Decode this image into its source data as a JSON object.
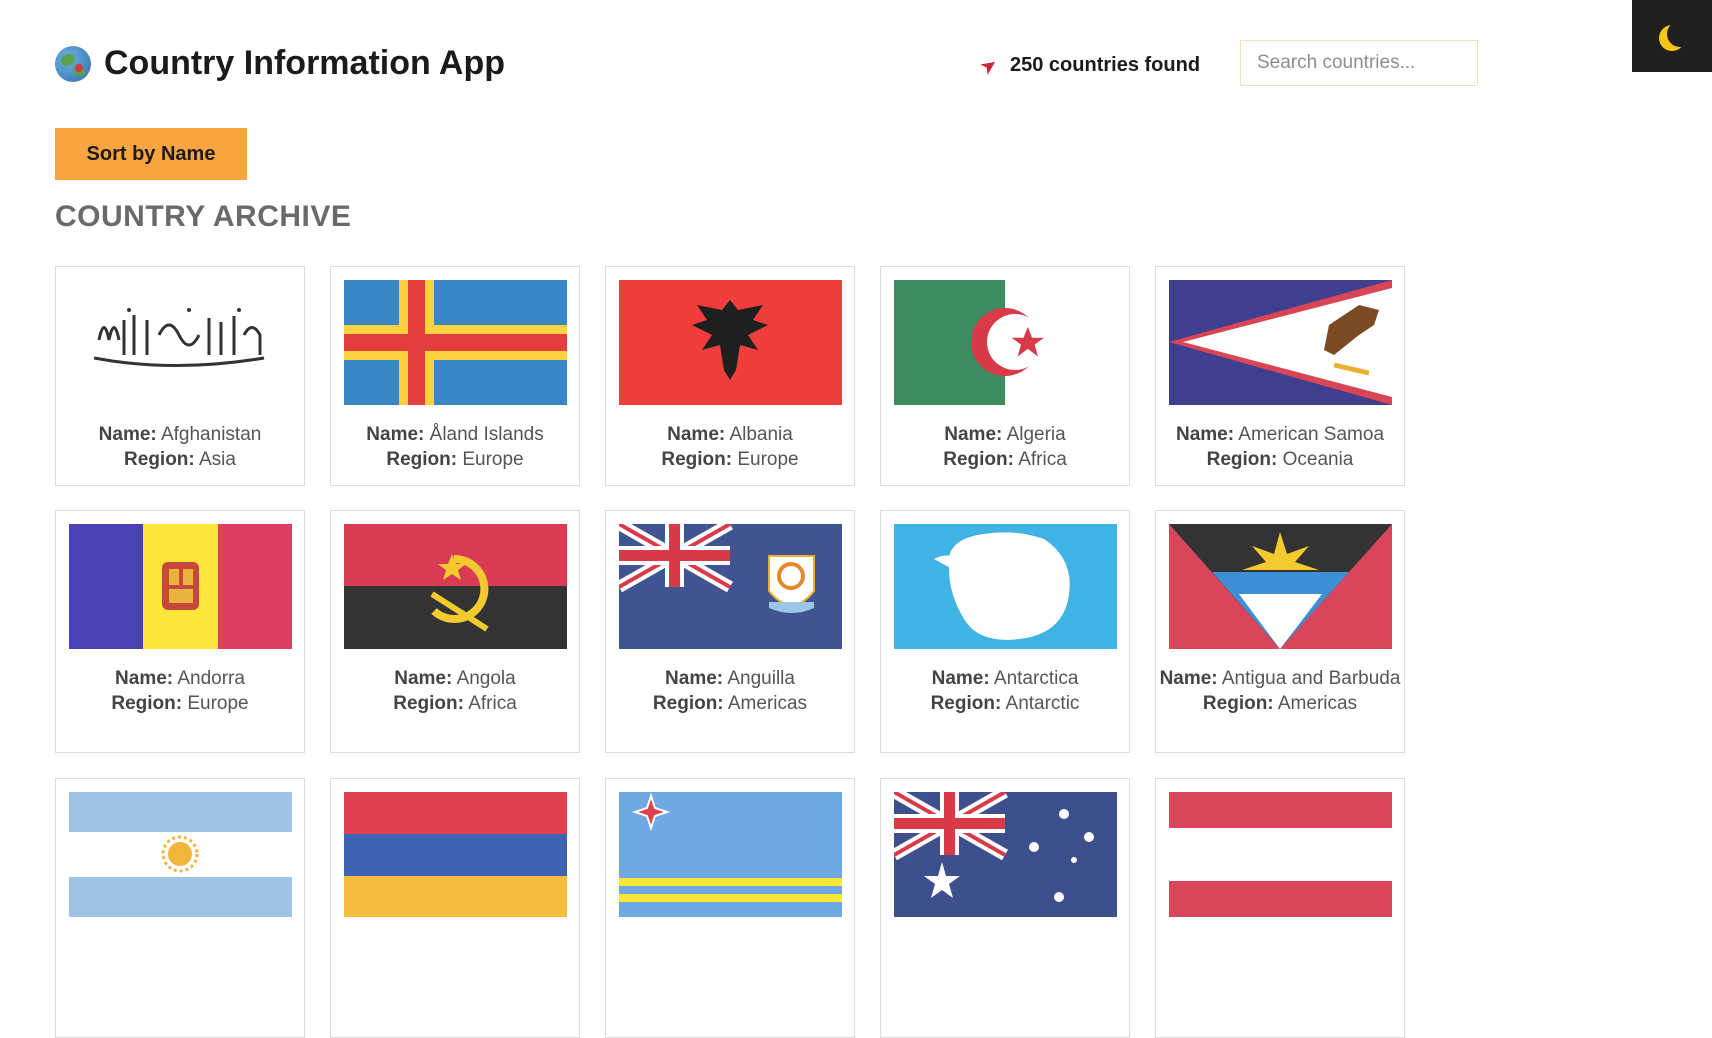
{
  "header": {
    "title": "Country Information App",
    "count_text": "250 countries found",
    "search_placeholder": "Search countries..."
  },
  "toolbar": {
    "sort_label": "Sort by Name"
  },
  "section_title": "COUNTRY ARCHIVE",
  "labels": {
    "name": "Name:",
    "region": "Region:"
  },
  "countries": [
    {
      "name": "Afghanistan",
      "region": "Asia",
      "flag": "afghanistan-flag"
    },
    {
      "name": "Åland Islands",
      "region": "Europe",
      "flag": "aland-flag"
    },
    {
      "name": "Albania",
      "region": "Europe",
      "flag": "albania-flag"
    },
    {
      "name": "Algeria",
      "region": "Africa",
      "flag": "algeria-flag"
    },
    {
      "name": "American Samoa",
      "region": "Oceania",
      "flag": "american-samoa-flag"
    },
    {
      "name": "Andorra",
      "region": "Europe",
      "flag": "andorra-flag"
    },
    {
      "name": "Angola",
      "region": "Africa",
      "flag": "angola-flag"
    },
    {
      "name": "Anguilla",
      "region": "Americas",
      "flag": "anguilla-flag"
    },
    {
      "name": "Antarctica",
      "region": "Antarctic",
      "flag": "antarctica-flag"
    },
    {
      "name": "Antigua and Barbuda",
      "region": "Americas",
      "flag": "antigua-flag"
    },
    {
      "name": "",
      "region": "",
      "flag": "argentina-flag"
    },
    {
      "name": "",
      "region": "",
      "flag": "armenia-flag"
    },
    {
      "name": "",
      "region": "",
      "flag": "aruba-flag"
    },
    {
      "name": "",
      "region": "",
      "flag": "australia-flag"
    },
    {
      "name": "",
      "region": "",
      "flag": "austria-flag"
    }
  ],
  "colors": {
    "accent": "#f9a43f",
    "toggle_bg": "#1f1f1f",
    "moon": "#f5c518"
  }
}
